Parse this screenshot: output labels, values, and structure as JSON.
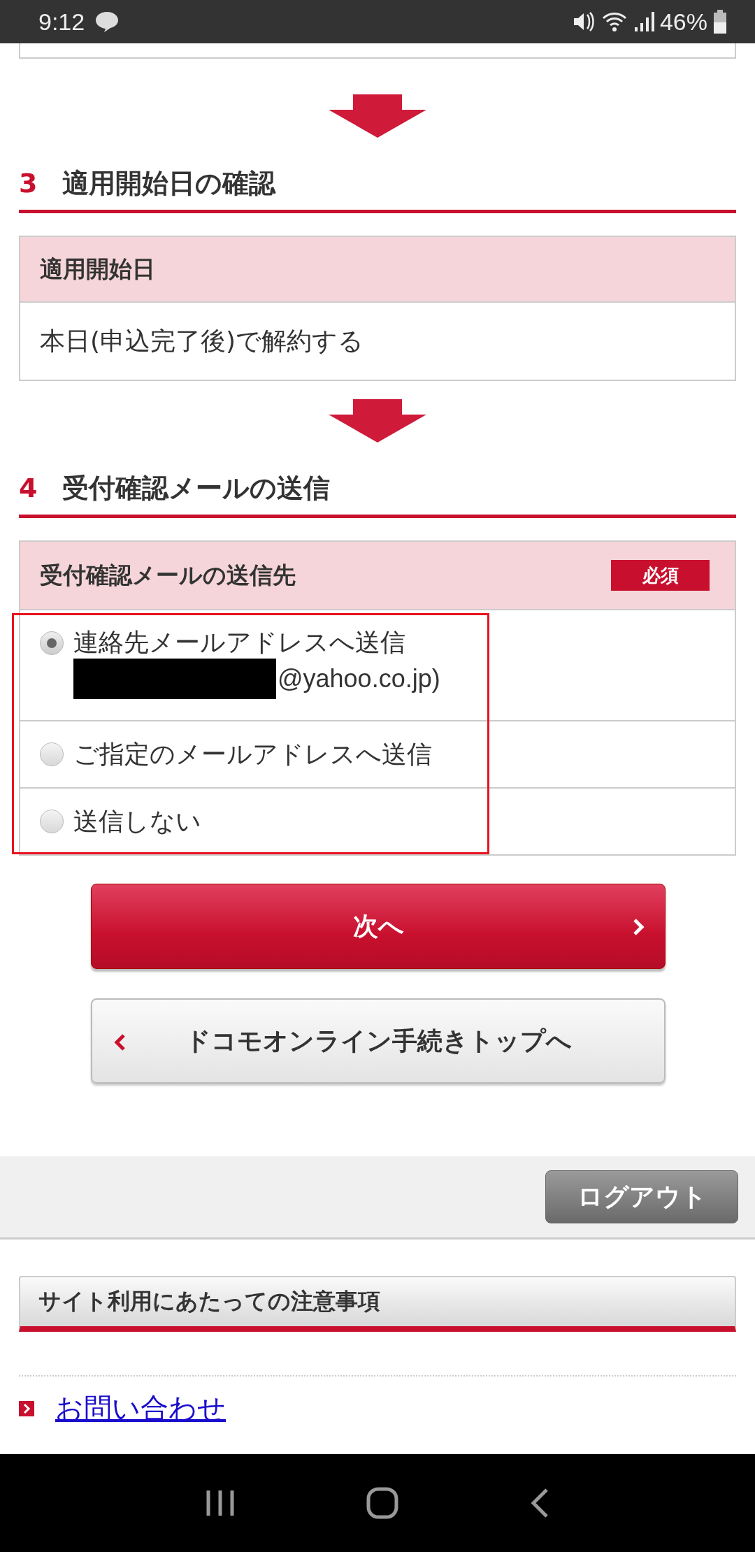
{
  "status_bar": {
    "time": "9:12",
    "battery": "46%"
  },
  "start_date_step": {
    "number": "3",
    "title": "適用開始日の確認",
    "heading": "適用開始日",
    "value": "本日(申込完了後)で解約する"
  },
  "mail_step": {
    "number": "4",
    "title": "受付確認メールの送信",
    "heading": "受付確認メールの送信先",
    "badge": "必須",
    "highlighted": true,
    "options": [
      {
        "label": "連絡先メールアドレスへ送信",
        "address": "@yahoo.co.jp)",
        "redacted": true,
        "selected": true
      },
      {
        "label": "ご指定のメールアドレスへ送信",
        "selected": false
      },
      {
        "label": "送信しない",
        "selected": false
      }
    ]
  },
  "buttons": {
    "next": "次へ",
    "back": "ドコモオンライン手続きトップへ"
  },
  "footer": {
    "logout": "ログアウト",
    "notes_heading": "サイト利用にあたっての注意事項",
    "links": [
      "お問い合わせ"
    ]
  }
}
